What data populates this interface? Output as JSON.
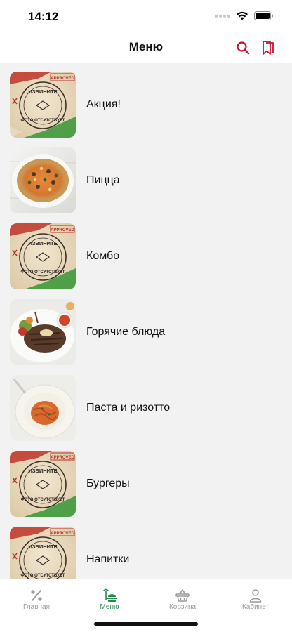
{
  "status": {
    "time": "14:12"
  },
  "header": {
    "title": "Меню"
  },
  "menu": {
    "items": [
      {
        "label": "Акция!",
        "image": "placeholder-stamp"
      },
      {
        "label": "Пицца",
        "image": "pizza-photo"
      },
      {
        "label": "Комбо",
        "image": "placeholder-stamp"
      },
      {
        "label": "Горячие блюда",
        "image": "steak-photo"
      },
      {
        "label": "Паста и ризотто",
        "image": "pasta-photo"
      },
      {
        "label": "Бургеры",
        "image": "placeholder-stamp"
      },
      {
        "label": "Напитки",
        "image": "placeholder-stamp"
      }
    ],
    "placeholder_text": {
      "approved": "APPROVED",
      "stamp_top": "ИЗВИНИТЕ",
      "stamp_bottom": "ФОТО ОТСУТСТВУЕТ"
    }
  },
  "tabbar": {
    "tabs": [
      {
        "label": "Главная",
        "icon": "percent-icon"
      },
      {
        "label": "Меню",
        "icon": "menu-tray-icon",
        "active": true
      },
      {
        "label": "Корзина",
        "icon": "basket-icon"
      },
      {
        "label": "Кабинет",
        "icon": "profile-icon"
      }
    ]
  },
  "colors": {
    "accent_red": "#c8102e",
    "accent_green": "#1f8a49",
    "background": "#f2f2f2"
  }
}
